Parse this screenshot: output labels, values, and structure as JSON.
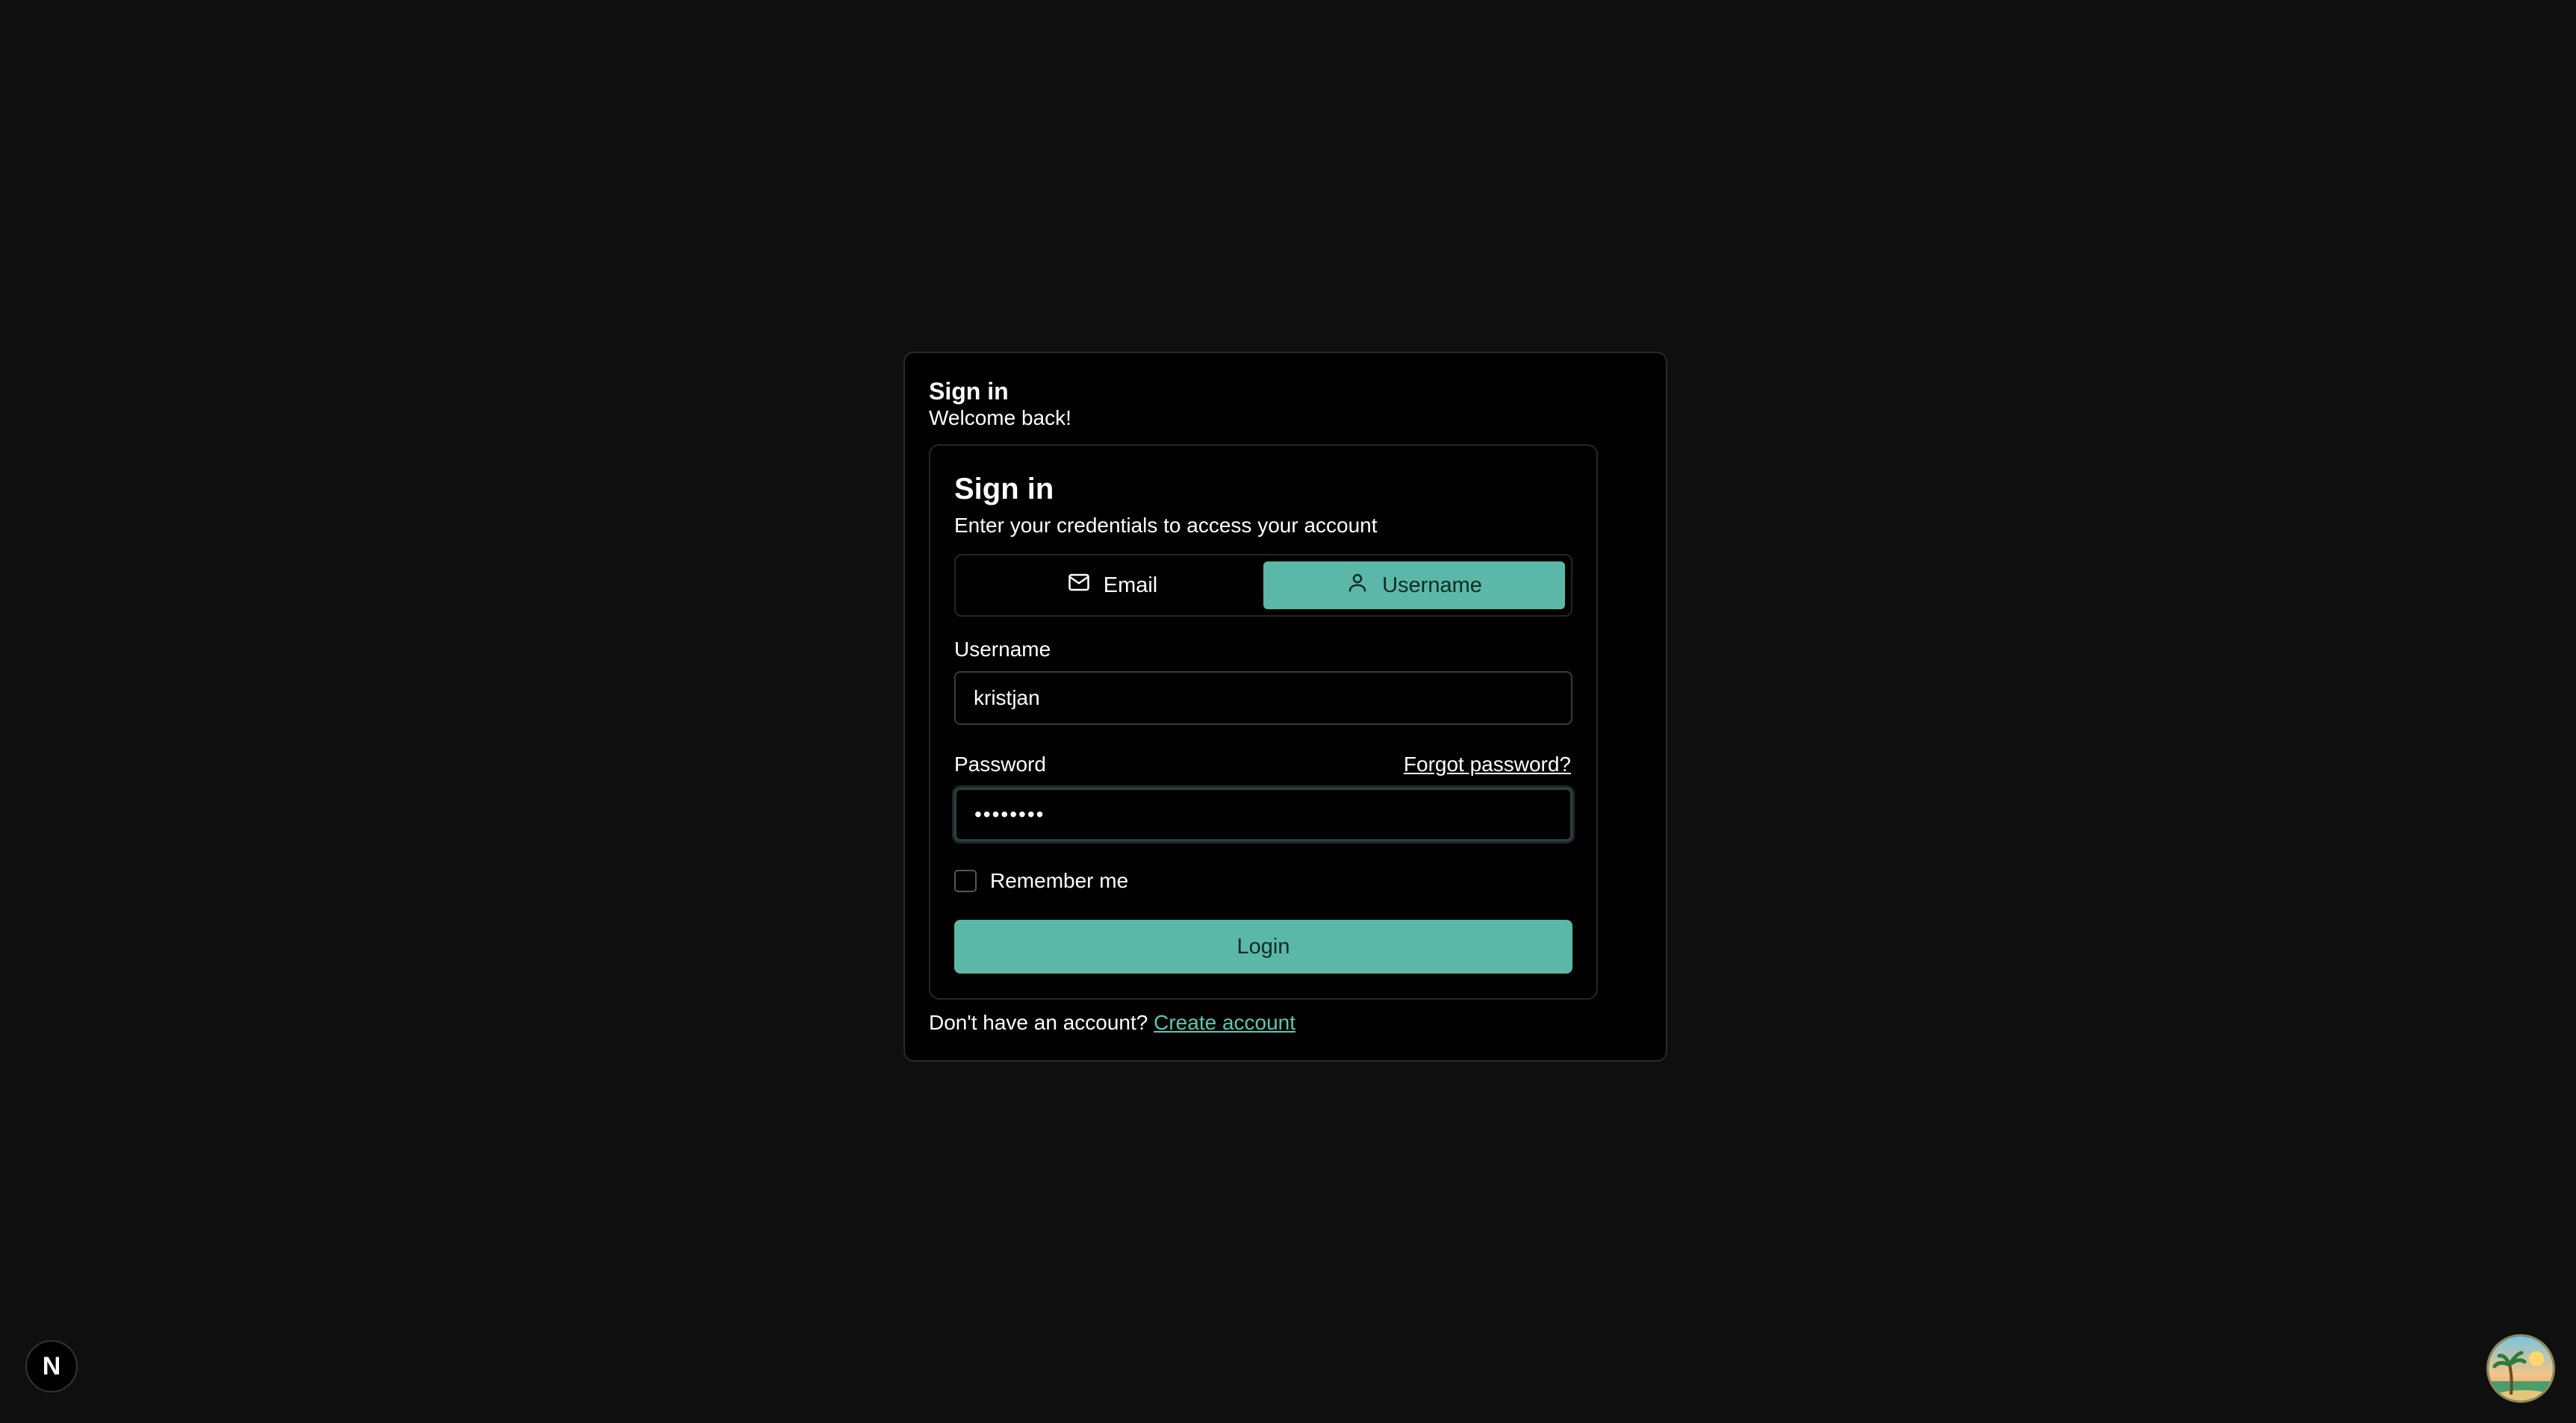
{
  "page": {
    "outer_title": "Sign in",
    "outer_subtitle": "Welcome back!"
  },
  "form": {
    "title": "Sign in",
    "subtitle": "Enter your credentials to access your account",
    "tabs": [
      {
        "label": "Email",
        "icon": "mail-icon",
        "active": false
      },
      {
        "label": "Username",
        "icon": "user-icon",
        "active": true
      }
    ],
    "username_label": "Username",
    "username_value": "kristjan",
    "password_label": "Password",
    "password_value": "••••••••",
    "forgot_label": "Forgot password?",
    "remember_label": "Remember me",
    "remember_checked": false,
    "login_label": "Login"
  },
  "footer": {
    "prompt": "Don't have an account?",
    "link": "Create account"
  },
  "badge": {
    "letter": "N"
  },
  "colors": {
    "accent": "#5bb8a8",
    "link": "#5bc7b5",
    "background": "#0f0f0f",
    "card": "#000000"
  }
}
